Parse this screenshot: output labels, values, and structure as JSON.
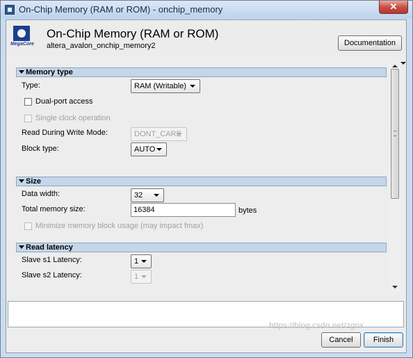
{
  "window": {
    "title": "On-Chip Memory (RAM or ROM) - onchip_memory",
    "close_glyph": "✕"
  },
  "header": {
    "logo_text": "MegaCore",
    "title": "On-Chip Memory (RAM or ROM)",
    "subtitle": "altera_avalon_onchip_memory2",
    "documentation_label": "Documentation"
  },
  "memory_type": {
    "section_label": "Memory type",
    "type_label": "Type:",
    "type_value": "RAM (Writable)",
    "dual_port_label": "Dual-port access",
    "single_clock_label": "Single clock operation",
    "rdw_label": "Read During Write Mode:",
    "rdw_value": "DONT_CARE",
    "block_type_label": "Block type:",
    "block_type_value": "AUTO"
  },
  "size": {
    "section_label": "Size",
    "data_width_label": "Data width:",
    "data_width_value": "32",
    "total_size_label": "Total memory size:",
    "total_size_value": "16384",
    "total_size_unit": "bytes",
    "minimize_label": "Minimize memory block usage (may impact fmax)"
  },
  "read_latency": {
    "section_label": "Read latency",
    "s1_label": "Slave s1 Latency:",
    "s1_value": "1",
    "s2_label": "Slave s2 Latency:",
    "s2_value": "1"
  },
  "footer": {
    "cancel_label": "Cancel",
    "finish_label": "Finish"
  },
  "watermark": "https://blog.csdn.net/zgnx"
}
